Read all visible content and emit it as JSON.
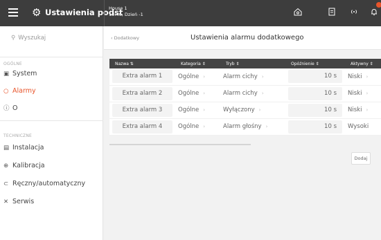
{
  "topbar": {
    "app_title": "Ustawienia podst",
    "house_name": "House 1",
    "datetime": "13:46, Dzień -1",
    "icons": [
      "home-icon",
      "clipboard-icon",
      "wifi-signal-icon",
      "bell-icon"
    ]
  },
  "sidebar": {
    "search_placeholder": "Wyszukaj",
    "section_general": "OGÓLNE",
    "section_technical": "TECHNICZNE",
    "general_items": [
      {
        "label": "System",
        "icon": "system-icon"
      },
      {
        "label": "Alarmy",
        "icon": "alarm-icon",
        "active": true
      },
      {
        "label": "O",
        "icon": "info-icon"
      }
    ],
    "technical_items": [
      {
        "label": "Instalacja",
        "icon": "installation-icon"
      },
      {
        "label": "Kalibracja",
        "icon": "calibration-icon"
      },
      {
        "label": "Ręczny/automatyczny",
        "icon": "manual-auto-icon"
      },
      {
        "label": "Serwis",
        "icon": "service-icon"
      }
    ]
  },
  "main": {
    "back_label": "Dodatkowy",
    "title": "Ustawienia alarmu dodatkowego",
    "columns": [
      "Nazwa ⇅",
      "Kategoria ⇕",
      "Tryb ⇕",
      "Opóźnienie ⇕",
      "Aktywny ⇕"
    ],
    "rows": [
      {
        "name": "Extra alarm 1",
        "category": "Ogólne",
        "mode": "Alarm cichy",
        "delay": "10 s",
        "active": "Niski"
      },
      {
        "name": "Extra alarm 2",
        "category": "Ogólne",
        "mode": "Alarm cichy",
        "delay": "10 s",
        "active": "Niski"
      },
      {
        "name": "Extra alarm 3",
        "category": "Ogólne",
        "mode": "Wyłączony",
        "delay": "10 s",
        "active": "Niski"
      },
      {
        "name": "Extra alarm 4",
        "category": "Ogólne",
        "mode": "Alarm głośny",
        "delay": "10 s",
        "active": "Wysoki"
      }
    ],
    "add_button": "Dodaj"
  },
  "colors": {
    "accent": "#e8542a",
    "topbar": "#3d3d3d",
    "table_header": "#444444"
  }
}
